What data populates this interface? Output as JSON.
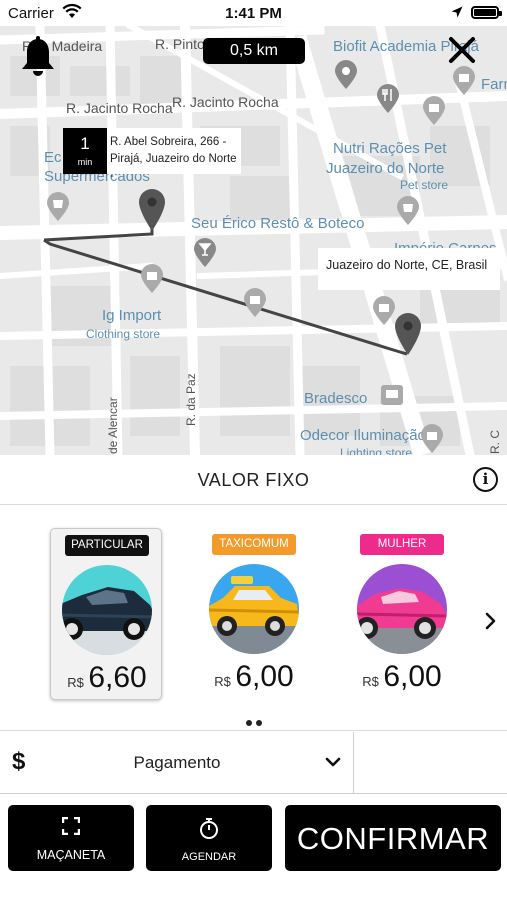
{
  "status_bar": {
    "carrier": "Carrier",
    "time": "1:41 PM"
  },
  "map": {
    "distance": "0,5 km",
    "eta": {
      "value": "1",
      "unit": "min"
    },
    "origin_address": "R. Abel Sobreira, 266 - Pirajá, Juazeiro do Norte -",
    "destination_address": "Juazeiro do Norte, CE, Brasil",
    "labels": {
      "street_1": "Rua Madeira",
      "street_2": "R. Pinto M",
      "street_3": "R. Jacinto Rocha",
      "street_4": "R. Jacinto Rocha",
      "street_5": "R. da Paz",
      "street_6": "de Alencar",
      "street_7": "R. C",
      "biofit": "Biofit Academia Pirajá",
      "farm": "Farm",
      "nutri_1": "Nutri Rações Pet",
      "nutri_2": "Juazeiro do Norte",
      "pet_store": "Pet store",
      "ec_1": "Ec",
      "ec_2": "Supermercados",
      "seu_erico": "Seu Érico Restô & Boteco",
      "imperio": "Império Carnes",
      "ig_import": "Ig Import",
      "clothing": "Clothing store",
      "bradesco": "Bradesco",
      "odecor": "Odecor Iluminação",
      "lighting": "Lighting store"
    }
  },
  "panel": {
    "title": "VALOR FIXO",
    "categories": [
      {
        "tag": "PARTICULAR",
        "tag_color": "#111111",
        "currency": "R$",
        "price": "6,60",
        "selected": true
      },
      {
        "tag": "TAXICOMUM",
        "tag_color": "#f39a2b",
        "currency": "R$",
        "price": "6,00",
        "selected": false
      },
      {
        "tag": "MULHER",
        "tag_color": "#ee2b8a",
        "currency": "R$",
        "price": "6,00",
        "selected": false
      }
    ],
    "payment": {
      "symbol": "$",
      "label": "Pagamento"
    }
  },
  "actions": {
    "macaneta": "MAÇANETA",
    "agendar": "AGENDAR",
    "confirmar": "CONFIRMAR"
  },
  "icons": [
    "bell-icon",
    "close-icon",
    "info-icon",
    "chevron-right-icon",
    "chevron-down-icon",
    "expand-icon",
    "stopwatch-icon",
    "map-pin-icon"
  ]
}
